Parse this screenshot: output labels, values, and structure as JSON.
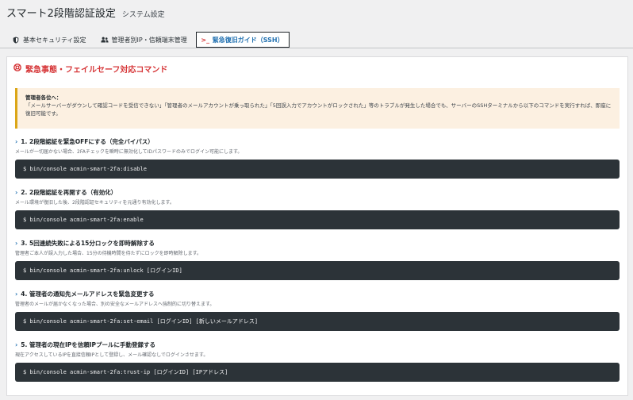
{
  "header": {
    "title": "スマート2段階認証設定",
    "subtitle": "システム設定"
  },
  "tabs": [
    {
      "label": "基本セキュリティ設定",
      "icon": "shield-icon",
      "active": false
    },
    {
      "label": "管理者別IP・信頼端末管理",
      "icon": "users-icon",
      "active": false
    },
    {
      "label": "緊急復旧ガイド（SSH）",
      "icon": "terminal-icon",
      "active": true
    }
  ],
  "panel": {
    "heading": "緊急事態・フェイルセーフ対応コマンド",
    "heading_icon": "sos-icon",
    "accent_color": "#d63638"
  },
  "notice": {
    "title": "管理者各位へ：",
    "body": "「メールサーバーがダウンして確認コードを受信できない」「管理者のメールアカウントが乗っ取られた」「5回誤入力でアカウントがロックされた」等のトラブルが発生した場合でも、サーバーのSSHターミナルから以下のコマンドを実行すれば、即座に復旧可能です。"
  },
  "steps": [
    {
      "title": "1. 2段階認証を緊急OFFにする（完全バイパス）",
      "desc": "メールが一切届かない場合、2FAチェックを瞬時に無効化してIDパスワードのみでログイン可能にします。",
      "command": "$ bin/console acmin-smart-2fa:disable"
    },
    {
      "title": "2. 2段階認証を再開する（有効化）",
      "desc": "メール環境が復旧した後、2段階認証セキュリティを元通り有効化します。",
      "command": "$ bin/console acmin-smart-2fa:enable"
    },
    {
      "title": "3. 5回連続失敗による15分ロックを即時解除する",
      "desc": "管理者ご本人が誤入力した場合、15分の待機時間を待たずにロックを即時解除します。",
      "command": "$ bin/console acmin-smart-2fa:unlock [ログインID]"
    },
    {
      "title": "4. 管理者の通知先メールアドレスを緊急変更する",
      "desc": "管理者のメールが届かなくなった場合、別の安全なメールアドレスへ強制的に切り替えます。",
      "command": "$ bin/console acmin-smart-2fa:set-email [ログインID] [新しいメールアドレス]"
    },
    {
      "title": "5. 管理者の現在IPを信頼IPプールに手動登録する",
      "desc": "現在アクセスしているIPを直接信頼IPとして登録し、メール確認なしでログインさせます。",
      "command": "$ bin/console acmin-smart-2fa:trust-ip [ログインID] [IPアドレス]"
    }
  ]
}
